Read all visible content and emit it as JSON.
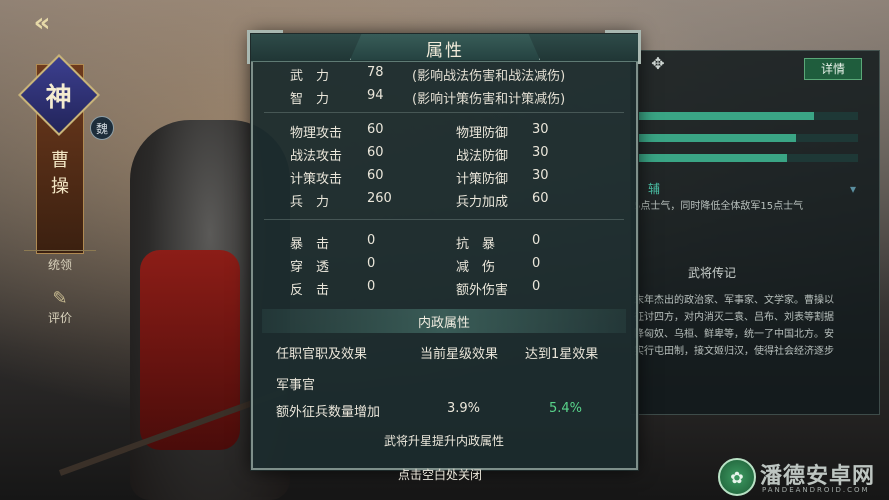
{
  "hero": {
    "tier": "神",
    "name": "曹操",
    "faction_glyph": "魏",
    "tabs": [
      {
        "label": "统领",
        "icon": "flag-icon"
      },
      {
        "label": "评价",
        "icon": "edit-icon"
      }
    ]
  },
  "dialog": {
    "title": "属性",
    "primary": [
      {
        "label": "武　力",
        "value": "78",
        "note": "(影响战法伤害和战法减伤)"
      },
      {
        "label": "智　力",
        "value": "94",
        "note": "(影响计策伤害和计策减伤)"
      }
    ],
    "combat": [
      {
        "left_label": "物理攻击",
        "left_value": "60",
        "right_label": "物理防御",
        "right_value": "30"
      },
      {
        "left_label": "战法攻击",
        "left_value": "60",
        "right_label": "战法防御",
        "right_value": "30"
      },
      {
        "left_label": "计策攻击",
        "left_value": "60",
        "right_label": "计策防御",
        "right_value": "30"
      },
      {
        "left_label": "兵　力",
        "left_value": "260",
        "right_label": "兵力加成",
        "right_value": "60"
      }
    ],
    "special": [
      {
        "left_label": "暴　击",
        "left_value": "0",
        "right_label": "抗　暴",
        "right_value": "0"
      },
      {
        "left_label": "穿　透",
        "left_value": "0",
        "right_label": "减　伤",
        "right_value": "0"
      },
      {
        "left_label": "反　击",
        "left_value": "0",
        "right_label": "额外伤害",
        "right_value": "0"
      }
    ],
    "internal": {
      "title": "内政属性",
      "headers": [
        "任职官职及效果",
        "当前星级效果",
        "达到1星效果"
      ],
      "office": "军事官",
      "effect_label": "额外征兵数量增加",
      "current_value": "3.9%",
      "next_value": "5.4%",
      "hint": "武将升星提升内政属性"
    }
  },
  "close_hint": "点击空白处关闭",
  "right_panel": {
    "detail_button": "详情",
    "tag": "辅",
    "skill_text": "5点士气，同时降低全体敌军15点士气",
    "bio_title": "武将传记",
    "bio_lines": [
      "末年杰出的政治家、军事家、文学家。曹操以",
      "征讨四方，对内消灭二袁、吕布、刘表等割据",
      "降匈奴、乌桓、鲜卑等，统一了中国北方。安",
      "实行屯田制，接文姬归汉，使得社会经济逐步"
    ],
    "bars": [
      0.8,
      0.72,
      0.68
    ]
  },
  "watermark": {
    "text": "潘德安卓网",
    "sub": "PANDEANDROID.COM"
  },
  "colors": {
    "accent_green": "#58d38a",
    "panel_bg": "#1c2c2e",
    "detail_button": "#1f5d3d"
  }
}
